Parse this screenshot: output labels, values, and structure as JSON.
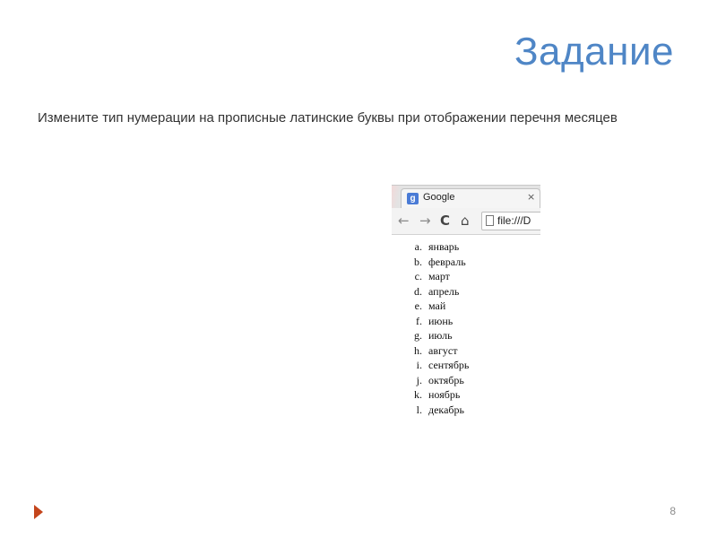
{
  "slide": {
    "title": "Задание",
    "task_text": "Измените тип нумерации на прописные латинские буквы при отображении перечня месяцев",
    "page_number": "8"
  },
  "browser": {
    "favicon_letter": "g",
    "tab_title": "Google",
    "tab_close": "×",
    "back_symbol": "←",
    "forward_symbol": "→",
    "reload_symbol": "C",
    "home_symbol": "⌂",
    "url": "file:///D",
    "months": [
      {
        "marker": "a.",
        "name": "январь"
      },
      {
        "marker": "b.",
        "name": "февраль"
      },
      {
        "marker": "c.",
        "name": "март"
      },
      {
        "marker": "d.",
        "name": "апрель"
      },
      {
        "marker": "e.",
        "name": "май"
      },
      {
        "marker": "f.",
        "name": "июнь"
      },
      {
        "marker": "g.",
        "name": "июль"
      },
      {
        "marker": "h.",
        "name": "август"
      },
      {
        "marker": "i.",
        "name": "сентябрь"
      },
      {
        "marker": "j.",
        "name": "октябрь"
      },
      {
        "marker": "k.",
        "name": "ноябрь"
      },
      {
        "marker": "l.",
        "name": "декабрь"
      }
    ]
  },
  "colors": {
    "title": "#4f86c6",
    "nav_arrow": "#c4451c"
  },
  "icons": [
    "google-favicon-icon",
    "back-arrow-icon",
    "forward-arrow-icon",
    "reload-icon",
    "home-icon",
    "page-icon",
    "next-slide-arrow-icon"
  ]
}
